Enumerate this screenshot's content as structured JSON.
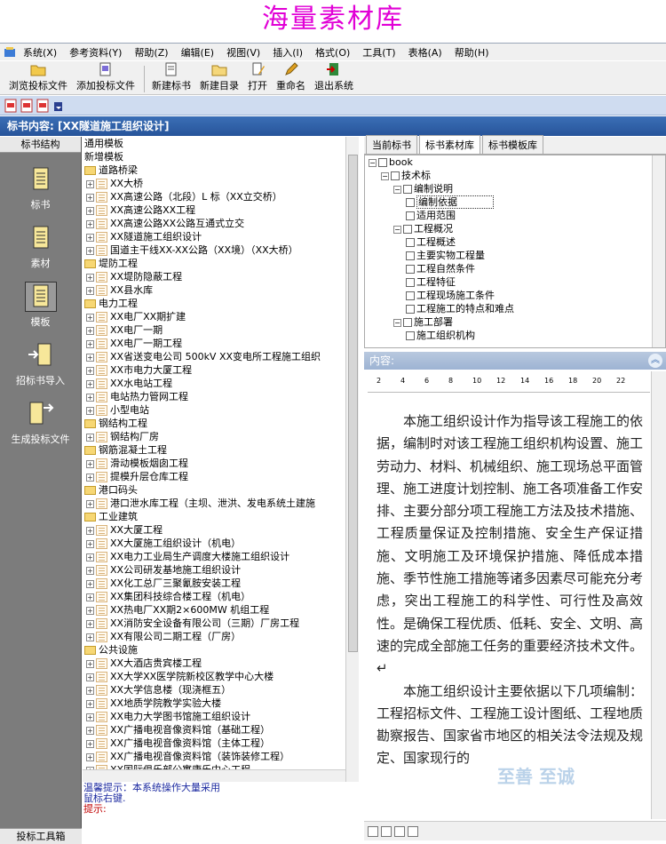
{
  "banner": {
    "title": "海量素材库",
    "color": "#e100d6"
  },
  "menu": [
    "系统(X)",
    "参考资料(Y)",
    "帮助(Z)",
    "编辑(E)",
    "视图(V)",
    "插入(I)",
    "格式(O)",
    "工具(T)",
    "表格(A)",
    "帮助(H)"
  ],
  "toolbar": [
    "浏览投标文件",
    "添加投标文件",
    "新建标书",
    "新建目录",
    "打开",
    "重命名",
    "退出系统"
  ],
  "doc_title": "标书内容: [XX隧道施工组织设计]",
  "left_panel": {
    "header": "标书结构",
    "items": [
      "标书",
      "素材",
      "模板",
      "招标书导入",
      "生成投标文件"
    ],
    "footer": "投标工具箱"
  },
  "tree": [
    {
      "t": "通用模板",
      "k": "plain",
      "d": 0
    },
    {
      "t": "新增模板",
      "k": "plain",
      "d": 0
    },
    {
      "t": "道路桥梁",
      "k": "folder",
      "d": 0
    },
    {
      "t": "XX大桥",
      "k": "doc",
      "d": 1
    },
    {
      "t": "XX高速公路（北段）L 标（XX立交桥）",
      "k": "doc",
      "d": 1
    },
    {
      "t": "XX高速公路XX工程",
      "k": "doc",
      "d": 1
    },
    {
      "t": "XX高速公路XX公路互通式立交",
      "k": "doc",
      "d": 1
    },
    {
      "t": "XX隧道施工组织设计",
      "k": "doc",
      "d": 1
    },
    {
      "t": "国道主干线XX-XX公路（XX境）（XX大桥）",
      "k": "doc",
      "d": 1
    },
    {
      "t": "堤防工程",
      "k": "folder",
      "d": 0
    },
    {
      "t": "XX堤防隐蔽工程",
      "k": "doc",
      "d": 1
    },
    {
      "t": "XX县水库",
      "k": "doc",
      "d": 1
    },
    {
      "t": "电力工程",
      "k": "folder",
      "d": 0
    },
    {
      "t": "XX电厂XX期扩建",
      "k": "doc",
      "d": 1
    },
    {
      "t": "XX电厂一期",
      "k": "doc",
      "d": 1
    },
    {
      "t": "XX电厂一期工程",
      "k": "doc",
      "d": 1
    },
    {
      "t": "XX省送变电公司 500kV XX变电所工程施工组织",
      "k": "doc",
      "d": 1
    },
    {
      "t": "XX市电力大厦工程",
      "k": "doc",
      "d": 1
    },
    {
      "t": "XX水电站工程",
      "k": "doc",
      "d": 1
    },
    {
      "t": "电站热力管网工程",
      "k": "doc",
      "d": 1
    },
    {
      "t": "小型电站",
      "k": "doc",
      "d": 1
    },
    {
      "t": "钢结构工程",
      "k": "folder",
      "d": 0
    },
    {
      "t": "钢结构厂房",
      "k": "doc",
      "d": 1
    },
    {
      "t": "钢筋混凝土工程",
      "k": "folder",
      "d": 0
    },
    {
      "t": "滑动模板烟囱工程",
      "k": "doc",
      "d": 1
    },
    {
      "t": "提模升层仓库工程",
      "k": "doc",
      "d": 1
    },
    {
      "t": "港口码头",
      "k": "folder",
      "d": 0
    },
    {
      "t": "港口泄水库工程（主坝、泄洪、发电系统土建施",
      "k": "doc",
      "d": 1
    },
    {
      "t": "工业建筑",
      "k": "folder",
      "d": 0
    },
    {
      "t": "XX大厦工程",
      "k": "doc",
      "d": 1
    },
    {
      "t": "XX大厦施工组织设计（机电）",
      "k": "doc",
      "d": 1
    },
    {
      "t": "XX电力工业局生产调度大楼施工组织设计",
      "k": "doc",
      "d": 1
    },
    {
      "t": "XX公司研发基地施工组织设计",
      "k": "doc",
      "d": 1
    },
    {
      "t": "XX化工总厂三聚氰胺安装工程",
      "k": "doc",
      "d": 1
    },
    {
      "t": "XX集团科技综合楼工程（机电）",
      "k": "doc",
      "d": 1
    },
    {
      "t": "XX热电厂XX期2×600MW 机组工程",
      "k": "doc",
      "d": 1
    },
    {
      "t": "XX消防安全设备有限公司（三期）厂房工程",
      "k": "doc",
      "d": 1
    },
    {
      "t": "XX有限公司二期工程（厂房）",
      "k": "doc",
      "d": 1
    },
    {
      "t": "公共设施",
      "k": "folder",
      "d": 0
    },
    {
      "t": "XX大酒店贵宾楼工程",
      "k": "doc",
      "d": 1
    },
    {
      "t": "XX大学XX医学院新校区教学中心大楼",
      "k": "doc",
      "d": 1
    },
    {
      "t": "XX大学信息楼（现浇框五）",
      "k": "doc",
      "d": 1
    },
    {
      "t": "XX地质学院教学实验大楼",
      "k": "doc",
      "d": 1
    },
    {
      "t": "XX电力大学图书馆施工组织设计",
      "k": "doc",
      "d": 1
    },
    {
      "t": "XX广播电视音像资料馆（基础工程）",
      "k": "doc",
      "d": 1
    },
    {
      "t": "XX广播电视音像资料馆（主体工程）",
      "k": "doc",
      "d": 1
    },
    {
      "t": "XX广播电视音像资料馆（装饰装修工程）",
      "k": "doc",
      "d": 1
    },
    {
      "t": "XX国际俱乐部公寓康乐中心工程",
      "k": "doc",
      "d": 1
    }
  ],
  "hint": {
    "line1": "温馨提示：本系统操作大量采用",
    "line2": "鼠标右键.",
    "line3": "提示:"
  },
  "right_tabs": [
    "当前标书",
    "标书素材库",
    "标书模板库"
  ],
  "outline": [
    {
      "t": "book",
      "d": 0,
      "sel": false
    },
    {
      "t": "技术标",
      "d": 1,
      "sel": false
    },
    {
      "t": "编制说明",
      "d": 2,
      "sel": false
    },
    {
      "t": "编制依据",
      "d": 3,
      "sel": true
    },
    {
      "t": "适用范围",
      "d": 3,
      "sel": false
    },
    {
      "t": "工程概况",
      "d": 2,
      "sel": false
    },
    {
      "t": "工程概述",
      "d": 3,
      "sel": false
    },
    {
      "t": "主要实物工程量",
      "d": 3,
      "sel": false
    },
    {
      "t": "工程自然条件",
      "d": 3,
      "sel": false
    },
    {
      "t": "工程特征",
      "d": 3,
      "sel": false
    },
    {
      "t": "工程现场施工条件",
      "d": 3,
      "sel": false
    },
    {
      "t": "工程施工的特点和难点",
      "d": 3,
      "sel": false
    },
    {
      "t": "施工部署",
      "d": 2,
      "sel": false
    },
    {
      "t": "施工组织机构",
      "d": 3,
      "sel": false
    }
  ],
  "content_label": "内容:",
  "ruler": [
    "2",
    "4",
    "6",
    "8",
    "10",
    "12",
    "14",
    "16",
    "18",
    "20",
    "22"
  ],
  "doc": {
    "p1": "本施工组织设计作为指导该工程施工的依据，编制时对该工程施工组织机构设置、施工劳动力、材料、机械组织、施工现场总平面管理、施工进度计划控制、施工各项准备工作安排、主要分部分项工程施工方法及技术措施、工程质量保证及控制措施、安全生产保证措施、文明施工及环境保护措施、降低成本措施、季节性施工措施等诸多因素尽可能充分考虑，突出工程施工的科学性、可行性及高效性。是确保工程优质、低耗、安全、文明、高速的完成全部施工任务的重要经济技术文件。↵",
    "p2": "本施工组织设计主要依据以下几项编制：工程招标文件、工程施工设计图纸、工程地质勘察报告、国家省市地区的相关法令法规及规定、国家现行的"
  },
  "watermark": "至善 至诚"
}
